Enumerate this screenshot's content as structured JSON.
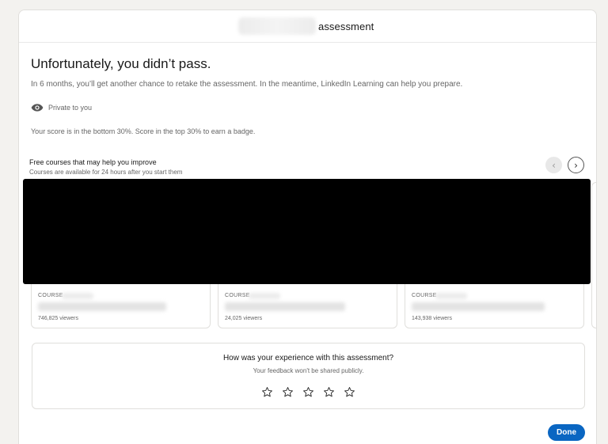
{
  "header": {
    "title": "assessment"
  },
  "result": {
    "headline": "Unfortunately, you didn’t pass.",
    "subtext": "In 6 months, you’ll get another chance to retake the assessment. In the meantime, LinkedIn Learning can help you prepare.",
    "privacy_label": "Private to you",
    "privacy_icon": "eye-icon",
    "score_text": "Your score is in the bottom 30%. Score in the top 30% to earn a badge."
  },
  "courses": {
    "title": "Free courses that may help you improve",
    "subtitle": "Courses are available for 24 hours after you start them",
    "prev_glyph": "‹",
    "next_glyph": "›",
    "cards": [
      {
        "type_label": "COURSE",
        "viewers": "746,825 viewers"
      },
      {
        "type_label": "COURSE",
        "viewers": "24,025 viewers"
      },
      {
        "type_label": "COURSE",
        "viewers": "143,938 viewers"
      }
    ]
  },
  "feedback": {
    "question": "How was your experience with this assessment?",
    "note": "Your feedback won't be shared publicly.",
    "star_count": 5
  },
  "footer": {
    "done_label": "Done"
  },
  "colors": {
    "primary": "#0a66c2",
    "text_muted": "#666666",
    "border": "#e0dfdc",
    "page_bg": "#f3f2ef"
  }
}
